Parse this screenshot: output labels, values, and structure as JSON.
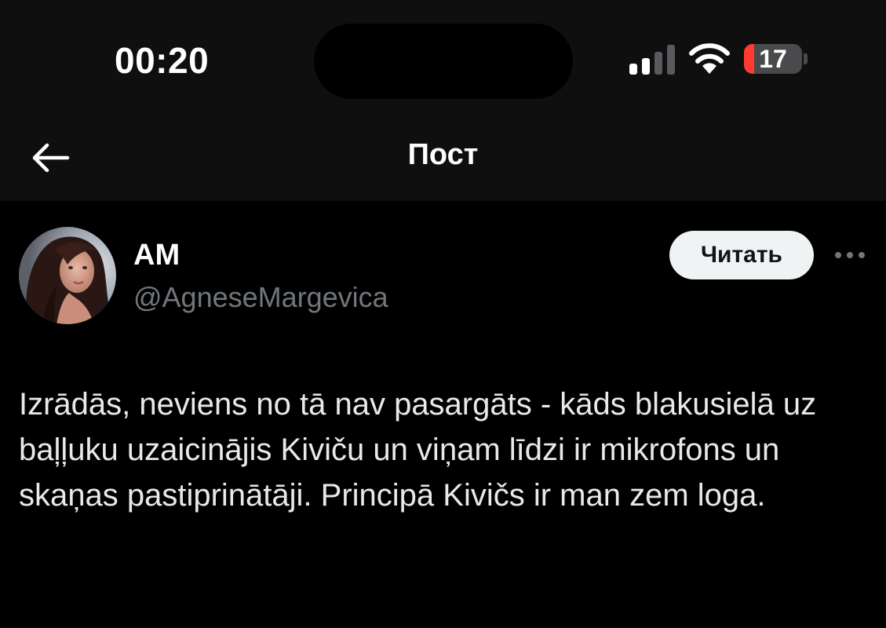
{
  "status_bar": {
    "time": "00:20",
    "battery_level": "17",
    "battery_fraction": 0.17,
    "battery_color": "#ff3b30",
    "icons": [
      "signal-icon",
      "wifi-icon",
      "battery-icon"
    ]
  },
  "nav": {
    "title": "Пост",
    "back_icon": "arrow-left-icon"
  },
  "post": {
    "author_name": "AM",
    "author_handle": "@AgneseMargevica",
    "follow_label": "Читать",
    "more_icon": "more-horizontal-icon",
    "text": "Izrādās, neviens no tā nav pasargāts - kāds blakusielā uz baļļuku uzaicinājis Kiviču un viņam līdzi ir mikrofons un skaņas pastiprinātāji. Principā Kivičs ir man zem loga."
  },
  "colors": {
    "background": "#000000",
    "bar_background": "#0f0f0f",
    "text_primary": "#e7e9ea",
    "text_secondary": "#71767b",
    "button_background": "#eff3f4"
  }
}
